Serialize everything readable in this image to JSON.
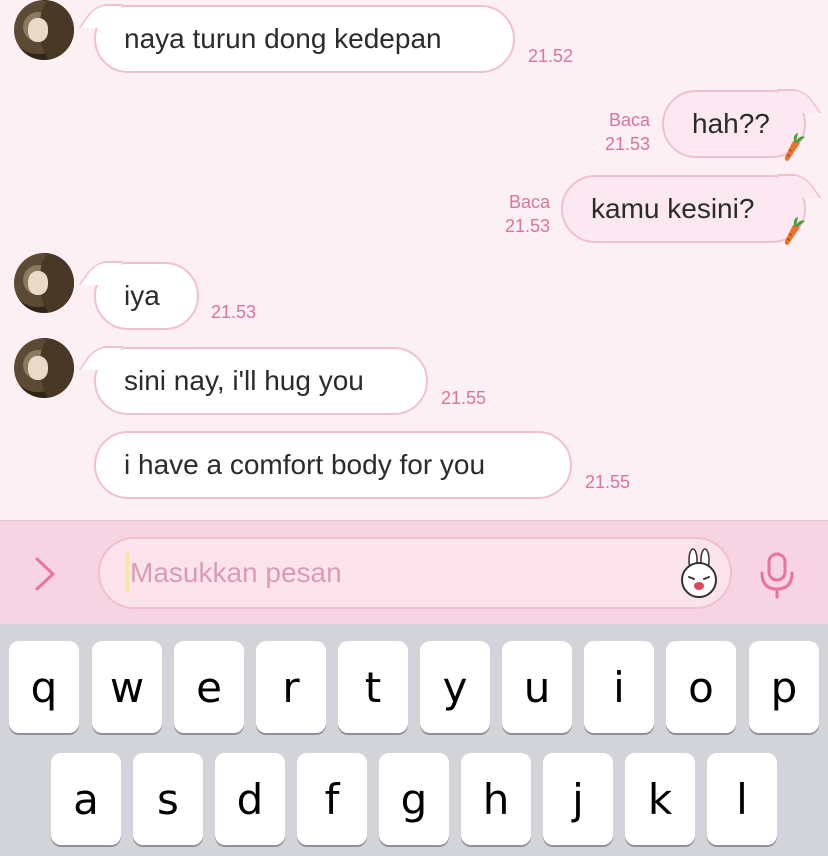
{
  "messages": [
    {
      "side": "in",
      "text": "naya turun dong kedepan",
      "time": "21.52"
    },
    {
      "side": "out",
      "text": "hah??",
      "status": "Baca",
      "time": "21.53",
      "sticker_icon": "carrot-icon"
    },
    {
      "side": "out",
      "text": "kamu kesini?",
      "status": "Baca",
      "time": "21.53",
      "sticker_icon": "carrot-icon"
    },
    {
      "side": "in",
      "text": "iya",
      "time": "21.53"
    },
    {
      "side": "in",
      "text": "sini nay, i'll hug you",
      "time": "21.55"
    },
    {
      "side": "in",
      "text": "i have a comfort body for you",
      "time": "21.55"
    }
  ],
  "input": {
    "placeholder": "Masukkan pesan",
    "expand_icon": "chevron-right-icon",
    "sticker_icon": "bunny-sticker-icon",
    "mic_icon": "microphone-icon"
  },
  "keyboard": {
    "row1": [
      "q",
      "w",
      "e",
      "r",
      "t",
      "y",
      "u",
      "i",
      "o",
      "p"
    ],
    "row2": [
      "a",
      "s",
      "d",
      "f",
      "g",
      "h",
      "j",
      "k",
      "l"
    ]
  },
  "colors": {
    "accent": "#e8739f",
    "chat_background": "#fcf0f5",
    "bubble_border": "#f0bfd3",
    "timestamp": "#d9749f",
    "input_bar": "#f7d4e2",
    "keyboard": "#d2d4d9"
  }
}
